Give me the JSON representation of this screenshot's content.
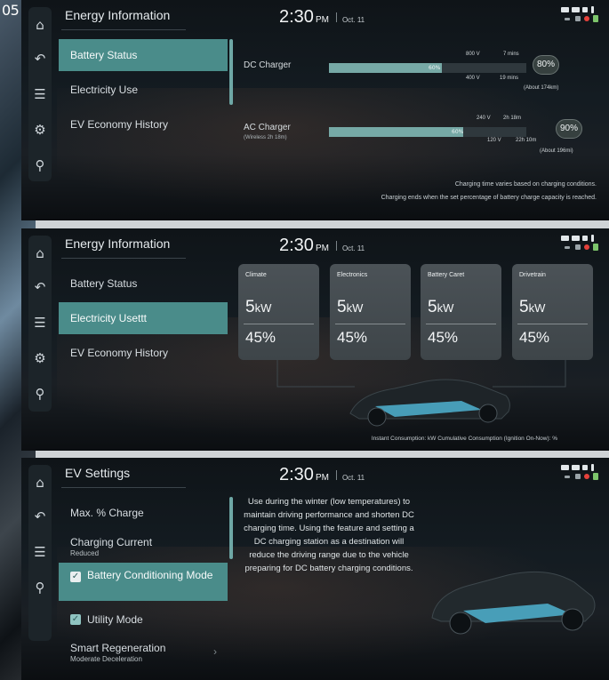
{
  "page_number": "05",
  "screens": [
    {
      "title": "Energy Information",
      "time": "2:30",
      "ampm": "PM",
      "date": "Oct. 11",
      "menu": [
        "Battery Status",
        "Electricity Use",
        "EV Economy History"
      ],
      "active_index": 0,
      "chargers": [
        {
          "label": "DC Charger",
          "sublabel": "",
          "fill_fraction": 0.57,
          "fill_text": "60%",
          "bubble": "80%",
          "top_voltage": "800 V",
          "top_time": "7 mins",
          "bottom_voltage": "400 V",
          "bottom_time": "19 mins",
          "range": "(About 174km)"
        },
        {
          "label": "AC Charger",
          "sublabel": "(Wireless 2h 18m)",
          "fill_fraction": 0.68,
          "fill_text": "60%",
          "bubble": "90%",
          "top_voltage": "240 V",
          "top_time": "2h 18m",
          "bottom_voltage": "120 V",
          "bottom_time": "22h 10m",
          "range": "(About 196mi)"
        }
      ],
      "note_line1": "Charging time varies based on charging conditions.",
      "note_line2": "Charging ends when the set percentage of battery charge capacity is reached."
    },
    {
      "title": "Energy Information",
      "time": "2:30",
      "ampm": "PM",
      "date": "Oct. 11",
      "menu": [
        "Battery Status",
        "Electricity Usettt",
        "EV Economy History"
      ],
      "active_index": 1,
      "cards": [
        {
          "label": "Climate",
          "kw": "5",
          "unit": "kW",
          "pct": "45%"
        },
        {
          "label": "Electronics",
          "kw": "5",
          "unit": "kW",
          "pct": "45%"
        },
        {
          "label": "Battery Caret",
          "kw": "5",
          "unit": "kW",
          "pct": "45%"
        },
        {
          "label": "Drivetrain",
          "kw": "5",
          "unit": "kW",
          "pct": "45%"
        }
      ],
      "footnote": "Instant Consumption: kW Cumulative Consumption (Ignition On-Now): %"
    },
    {
      "title": "EV Settings",
      "time": "2:30",
      "ampm": "PM",
      "date": "Oct. 11",
      "menu": [
        {
          "label": "Max. % Charge",
          "sub": ""
        },
        {
          "label": "Charging Current",
          "sub": "Reduced"
        },
        {
          "label": "Battery Conditioning Mode",
          "sub": "",
          "checked": true
        },
        {
          "label": "Utility Mode",
          "sub": "",
          "checked": true
        },
        {
          "label": "Smart Regeneration",
          "sub": "Moderate Deceleration"
        }
      ],
      "active_index": 2,
      "description": "Use during the winter (low temperatures) to maintain driving performance and shorten DC charging time. Using the feature and setting a DC charging station as a destination will reduce the driving range due to the vehicle preparing for DC battery charging conditions."
    }
  ],
  "colors": {
    "accent": "#4a8c8a",
    "bar_fill": "#76a9a6",
    "card_bg": "#474e52",
    "status_red": "#e5413b",
    "status_green": "#7cc46b"
  },
  "icons": [
    "home-icon",
    "back-icon",
    "menu-icon",
    "settings-icon",
    "search-icon"
  ]
}
